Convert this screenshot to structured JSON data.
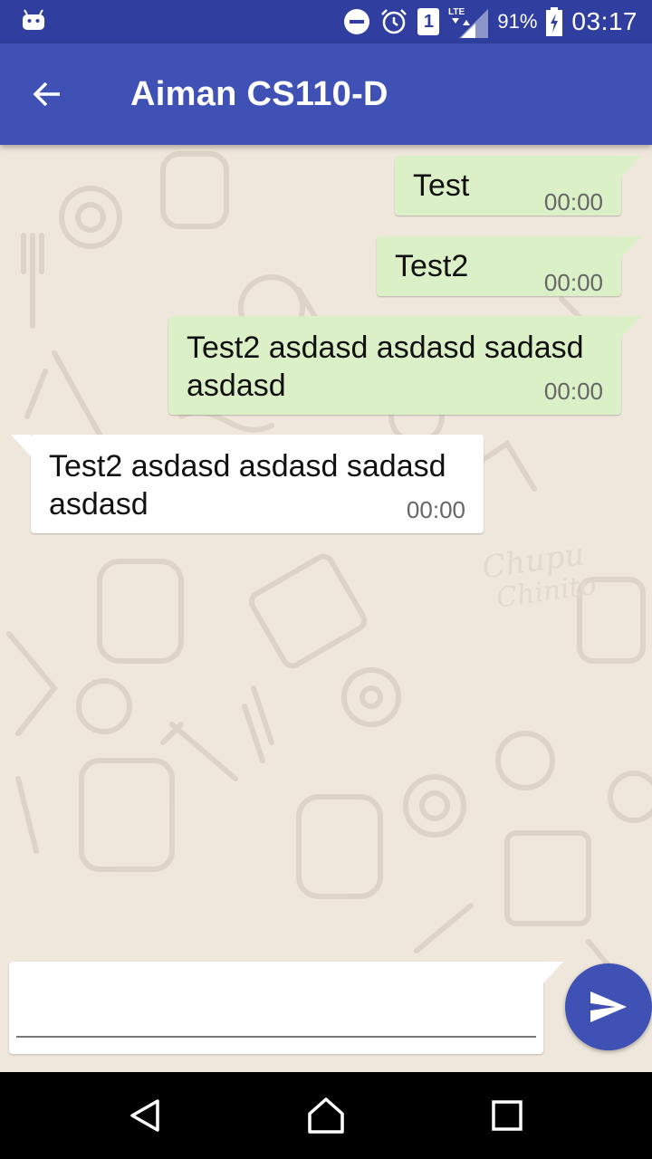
{
  "status_bar": {
    "battery": "91%",
    "time": "03:17",
    "sim": "1",
    "network": "LTE",
    "icons": [
      "android-debug-icon",
      "do-not-disturb-icon",
      "alarm-icon",
      "sim-1-icon",
      "lte-signal-icon",
      "battery-charging-icon"
    ]
  },
  "toolbar": {
    "title": "Aiman CS110-D",
    "back_icon": "arrow-left-icon"
  },
  "messages": [
    {
      "direction": "out",
      "text": "Test",
      "time": "00:00"
    },
    {
      "direction": "out",
      "text": "Test2",
      "time": "00:00"
    },
    {
      "direction": "out",
      "text": "Test2 asdasd asdasd sadasd asdasd",
      "time": "00:00"
    },
    {
      "direction": "in",
      "text": "Test2 asdasd asdasd sadasd asdasd",
      "time": "00:00"
    }
  ],
  "composer": {
    "value": "",
    "placeholder": "",
    "send_icon": "send-icon"
  },
  "nav_bar": {
    "icons": [
      "back-triangle-icon",
      "home-icon",
      "recents-icon"
    ]
  },
  "colors": {
    "status_bar": "#303f9f",
    "toolbar": "#3f51b5",
    "outgoing_bubble": "#dcf0c8",
    "incoming_bubble": "#ffffff",
    "chat_background": "#efe7dc",
    "send_button": "#3f51b5"
  }
}
